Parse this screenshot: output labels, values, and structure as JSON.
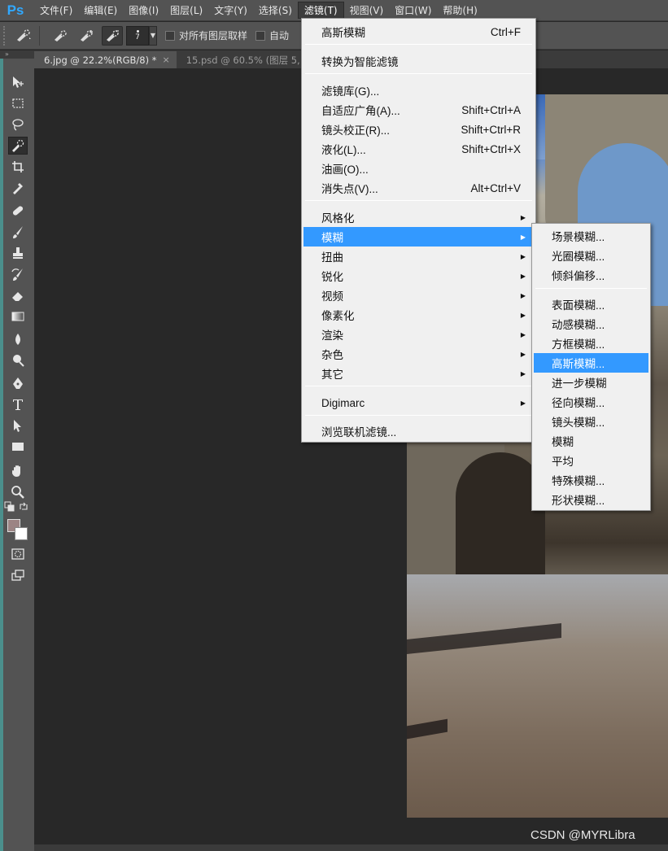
{
  "app": {
    "logo": "Ps"
  },
  "menubar": {
    "items": [
      {
        "label": "文件(F)"
      },
      {
        "label": "编辑(E)"
      },
      {
        "label": "图像(I)"
      },
      {
        "label": "图层(L)"
      },
      {
        "label": "文字(Y)"
      },
      {
        "label": "选择(S)"
      },
      {
        "label": "滤镜(T)",
        "active": true
      },
      {
        "label": "视图(V)"
      },
      {
        "label": "窗口(W)"
      },
      {
        "label": "帮助(H)"
      }
    ]
  },
  "options": {
    "brush_size": "7",
    "sample_all_layers": "对所有图层取样",
    "auto_enhance": "自动"
  },
  "tabs": [
    {
      "label": "6.jpg @ 22.2%(RGB/8) *",
      "close": "×"
    },
    {
      "label": "15.psd @ 60.5% (图层 5, RGB"
    }
  ],
  "filter_menu": {
    "last_filter": {
      "label": "高斯模糊",
      "shortcut": "Ctrl+F"
    },
    "smart_filter": "转换为智能滤镜",
    "gallery_items": [
      {
        "label": "滤镜库(G)...",
        "shortcut": ""
      },
      {
        "label": "自适应广角(A)...",
        "shortcut": "Shift+Ctrl+A"
      },
      {
        "label": "镜头校正(R)...",
        "shortcut": "Shift+Ctrl+R"
      },
      {
        "label": "液化(L)...",
        "shortcut": "Shift+Ctrl+X"
      },
      {
        "label": "油画(O)...",
        "shortcut": ""
      },
      {
        "label": "消失点(V)...",
        "shortcut": "Alt+Ctrl+V"
      }
    ],
    "categories": [
      {
        "label": "风格化"
      },
      {
        "label": "模糊",
        "highlighted": true
      },
      {
        "label": "扭曲"
      },
      {
        "label": "锐化"
      },
      {
        "label": "视频"
      },
      {
        "label": "像素化"
      },
      {
        "label": "渲染"
      },
      {
        "label": "杂色"
      },
      {
        "label": "其它"
      }
    ],
    "digimarc": "Digimarc",
    "browse_online": "浏览联机滤镜..."
  },
  "blur_submenu": {
    "group1": [
      {
        "label": "场景模糊..."
      },
      {
        "label": "光圈模糊..."
      },
      {
        "label": "倾斜偏移..."
      }
    ],
    "group2": [
      {
        "label": "表面模糊..."
      },
      {
        "label": "动感模糊..."
      },
      {
        "label": "方框模糊..."
      },
      {
        "label": "高斯模糊...",
        "highlighted": true
      },
      {
        "label": "进一步模糊"
      },
      {
        "label": "径向模糊..."
      },
      {
        "label": "镜头模糊..."
      },
      {
        "label": "模糊"
      },
      {
        "label": "平均"
      },
      {
        "label": "特殊模糊..."
      },
      {
        "label": "形状模糊..."
      }
    ]
  },
  "colors": {
    "foreground": "#9c8484",
    "background": "#ffffff",
    "highlight": "#3399ff",
    "menu_bg": "#f0f0f0",
    "ui_dark": "#535353"
  },
  "watermark": "CSDN @MYRLibra"
}
